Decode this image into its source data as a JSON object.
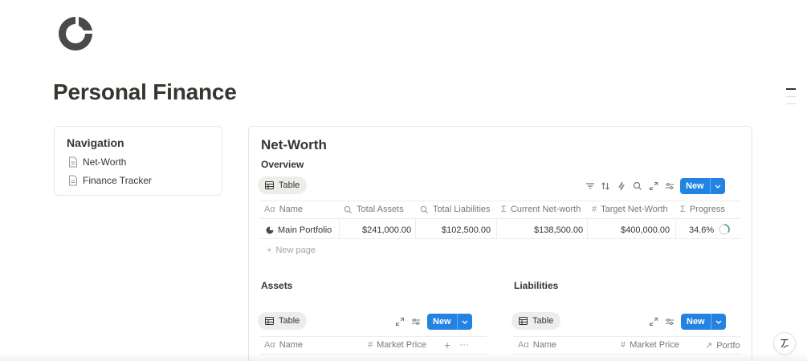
{
  "page": {
    "icon": "pie-chart-icon",
    "title": "Personal Finance"
  },
  "navigation": {
    "title": "Navigation",
    "items": [
      {
        "label": "Net-Worth",
        "icon": "document-icon"
      },
      {
        "label": "Finance Tracker",
        "icon": "document-icon"
      }
    ]
  },
  "networth": {
    "title": "Net-Worth",
    "overview": {
      "title": "Overview",
      "view_tab": "Table",
      "new_label": "New",
      "toolbar_icons": [
        "filter-icon",
        "sort-icon",
        "automation-icon",
        "search-icon",
        "expand-icon",
        "settings-icon"
      ],
      "columns": [
        {
          "label": "Name",
          "icon": "Aa"
        },
        {
          "label": "Total Assets",
          "icon": "search-icon"
        },
        {
          "label": "Total Liabilities",
          "icon": "search-icon"
        },
        {
          "label": "Current Net-worth",
          "icon": "Σ"
        },
        {
          "label": "Target Net-Worth",
          "icon": "#"
        },
        {
          "label": "Progress",
          "icon": "Σ"
        }
      ],
      "rows": [
        {
          "name": "Main Portfolio",
          "total_assets": "$241,000.00",
          "total_liabilities": "$102,500.00",
          "current_net_worth": "$138,500.00",
          "target_net_worth": "$400,000.00",
          "progress": "34.6%",
          "progress_fraction": 0.346
        }
      ],
      "new_page_label": "New page"
    },
    "assets": {
      "title": "Assets",
      "view_tab": "Table",
      "new_label": "New",
      "columns": [
        {
          "label": "Name",
          "icon": "Aa"
        },
        {
          "label": "Market Price",
          "icon": "#"
        }
      ]
    },
    "liabilities": {
      "title": "Liabilities",
      "view_tab": "Table",
      "new_label": "New",
      "columns": [
        {
          "label": "Name",
          "icon": "Aa"
        },
        {
          "label": "Market Price",
          "icon": "#"
        },
        {
          "label": "Portfo",
          "icon": "↗"
        }
      ]
    }
  },
  "colors": {
    "accent": "#2383e2",
    "text": "#37352f",
    "muted": "#787774",
    "progress": "#4dab9a"
  }
}
